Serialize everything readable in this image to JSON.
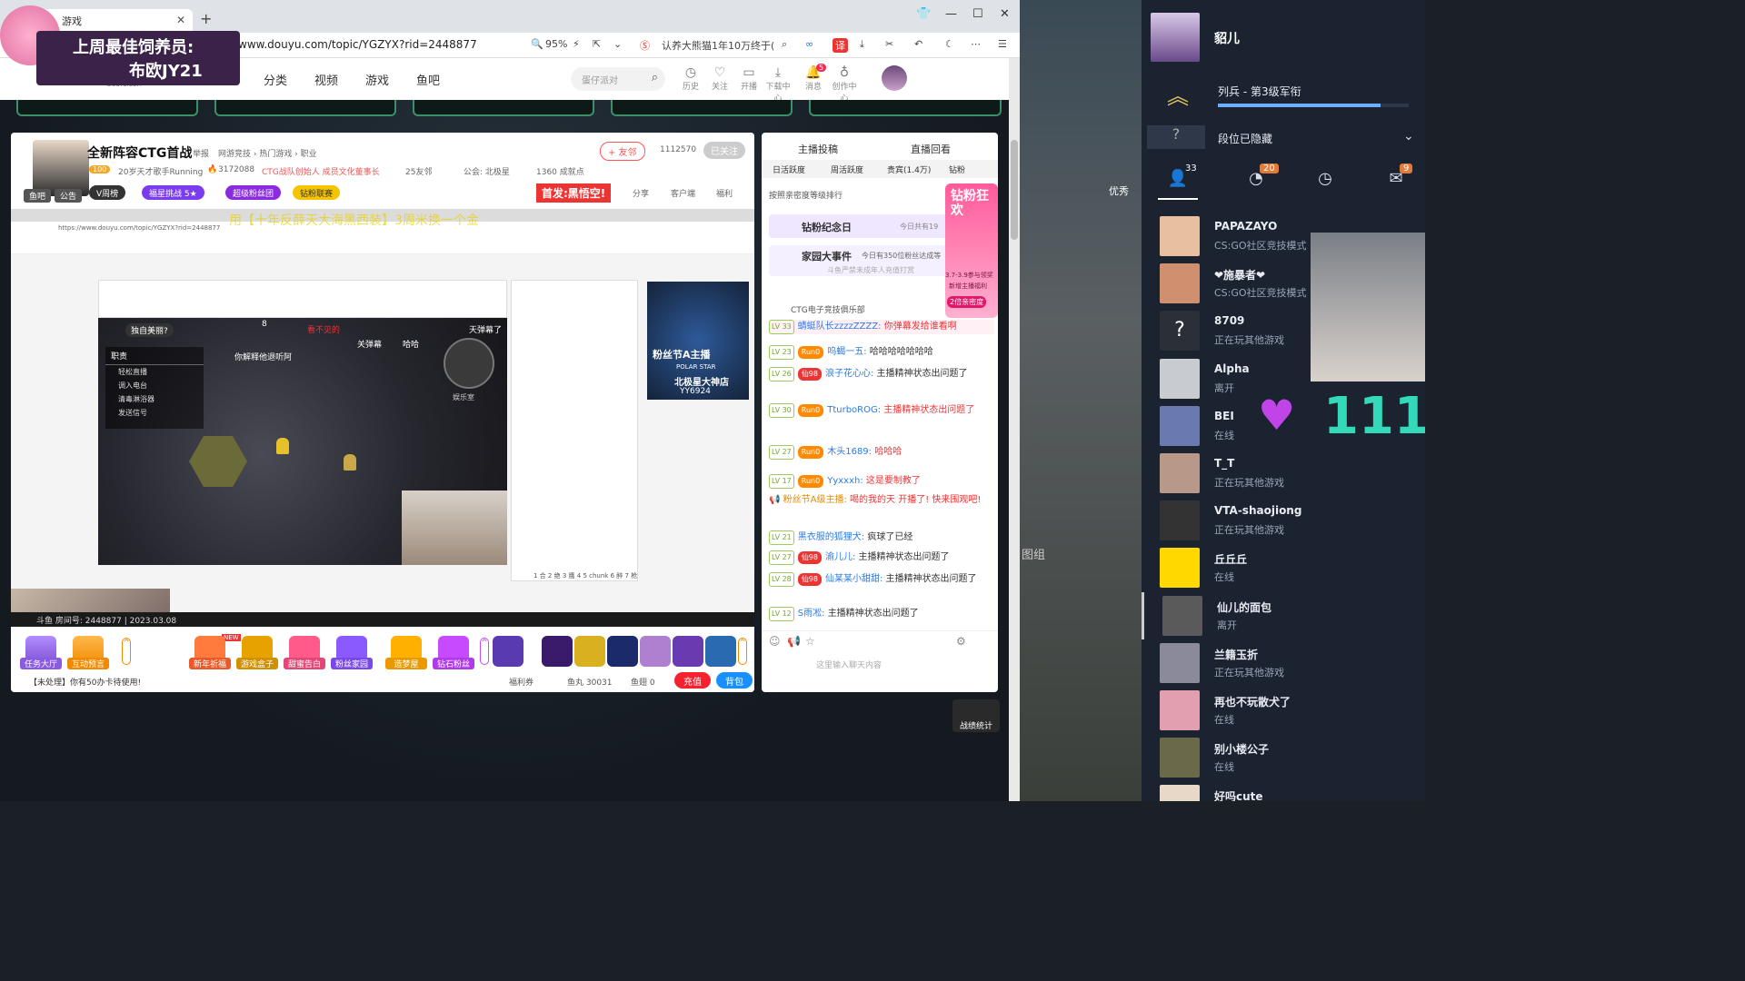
{
  "browser": {
    "tab_title": "游戏",
    "url": "www.douyu.com/topic/YGZYX?rid=2448877",
    "url_prefix": ".",
    "zoom": "95%",
    "news_ticker": "认养大熊猫1年10万终于(",
    "translate_badge": "译"
  },
  "overlay": {
    "line1": "上周最佳饲养员:",
    "line2": "布欧JY21"
  },
  "site": {
    "logo": "DOUYU.COM",
    "nav": [
      "分类",
      "视频",
      "游戏",
      "鱼吧"
    ],
    "search_placeholder": "蛋仔派对",
    "header_icons": [
      {
        "label": "历史"
      },
      {
        "label": "关注"
      },
      {
        "label": "开播"
      },
      {
        "label": "下载中心"
      },
      {
        "label": "消息",
        "badge": "5"
      },
      {
        "label": "创作中心"
      }
    ]
  },
  "room": {
    "title": "全新阵容CTG首战",
    "report": "举报",
    "breadcrumb": "网游竞技 › 热门游戏 › 职业",
    "follow_label": "+ 友邻",
    "follow_count": "1112570",
    "followed_label": "已关注",
    "level": "100",
    "desc": "20岁天才歌手Running",
    "hot": "3172088",
    "tag_line": "CTG战队创始人 成员文化董事长",
    "fans": "25友邻",
    "guild": "公会: 北极星",
    "achievements": "1360 成就点",
    "pills": [
      "V周榜",
      "福星挑战 5★",
      "超级粉丝团",
      "钻粉联赛"
    ],
    "tabs_left": [
      "鱼吧",
      "公告"
    ],
    "promo": "首发:黑悟空!",
    "actions": [
      "分享",
      "客户端",
      "福利"
    ]
  },
  "video": {
    "marquee": "用【十年反薛天大海黑西装】3周米换一个金",
    "nested_url": "https://www.douyu.com/topic/YGZYX?rid=2448877",
    "game_tags": [
      "独自美丽?",
      "看不见的",
      "关弹幕",
      "哈哈",
      "天弹幕了",
      "8",
      "你解释他退听阿"
    ],
    "duty_label": "职责",
    "duty_items": [
      "轻松直播",
      "调入电台",
      "清毒淋浴器",
      "发送信号"
    ],
    "room_label": "娱乐室",
    "bottom_info": "斗鱼 房间号: 2448877 | 2023.03.08",
    "festival": "粉丝节A主播",
    "festival_sub": "POLAR STAR",
    "polar": "北极星大神店",
    "polar_code": "YY6924",
    "nested_chat_tabs": [
      "1 合",
      "2 绝",
      "3 鹰",
      "4",
      "5 chunk",
      "6 醉",
      "7 枪"
    ]
  },
  "bottombar": {
    "buttons": [
      "任务大厅",
      "互动预言"
    ],
    "gift_labels": [
      "新年祈福",
      "游戏盒子",
      "甜蜜告白",
      "粉丝家园",
      "造梦屋",
      "钻石粉丝"
    ],
    "notice": "【未处理】你有50办卡待使用!",
    "new_tag": "NEW",
    "welfare": "福利券",
    "fish_balls": "鱼丸 30031",
    "fish_fins": "鱼翅 0",
    "recharge": "充值",
    "backpack": "背包"
  },
  "chat": {
    "top_tabs": [
      "主播投稿",
      "直播回看"
    ],
    "rank_tabs": [
      "日活跃度",
      "周活跃度",
      "贵宾(1.4万)",
      "钻粉"
    ],
    "rank_note": "按照亲密度等级排行",
    "diamond_day": "钻粉纪念日",
    "diamond_day_note": "今日共有19",
    "family_event": "家园大事件",
    "family_note": "今日有350位粉丝达成等",
    "family_sub": "斗鱼严禁未成年人充值打赏",
    "club": "CTG电子竞技俱乐部",
    "promo_tag": "钻粉狂欢",
    "promo_dates": "3.7-3.9参与领奖",
    "promo_sub": "新增主播福利",
    "promo_btn": "2倍亲密度",
    "messages": [
      {
        "lv": "LV 33",
        "user": "蜻蜓队长zzzzZZZZ:",
        "text": "你弹幕发给谁看啊"
      },
      {
        "lv": "LV 23",
        "badge": "Run0",
        "user": "呜蝎一五:",
        "text": "哈哈哈哈哈哈哈"
      },
      {
        "lv": "LV 26",
        "badge": "仙98",
        "user": "浪子花心心:",
        "text": "主播精神状态出问题了"
      },
      {
        "lv": "LV 30",
        "badge": "Run0",
        "user": "TturboROG:",
        "text": "主播精神状态出问题了"
      },
      {
        "lv": "LV 27",
        "badge": "Run0",
        "user": "木头1689:",
        "text": "哈哈哈"
      },
      {
        "lv": "LV 17",
        "badge": "Run0",
        "user": "Yyxxxh:",
        "text": "这是要制教了"
      },
      {
        "lv": "",
        "user": "粉丝节A级主播:",
        "text": "喝的我的天 开播了! 快来围观吧!"
      },
      {
        "lv": "LV 21",
        "user": "黑衣服的狐狸犬:",
        "text": "疯球了已经"
      },
      {
        "lv": "LV 27",
        "badge": "仙98",
        "user": "渝儿儿:",
        "text": "主播精神状态出问题了"
      },
      {
        "lv": "LV 28",
        "badge": "仙98",
        "user": "仙某某小甜甜:",
        "text": "主播精神状态出问题了"
      },
      {
        "lv": "LV 12",
        "user": "S雨凇:",
        "text": "主播精神状态出问题了"
      }
    ],
    "input_placeholder": "这里输入聊天内容",
    "stats_label": "战绩统计"
  },
  "friends": {
    "me": {
      "name": "貂儿",
      "rank": "列兵 - 第3级军衔",
      "rank_progress": 0.85,
      "segment": "段位已隐藏"
    },
    "tabs": [
      {
        "icon": "friends-icon",
        "count": "33"
      },
      {
        "icon": "broadcast-icon",
        "count": "20"
      },
      {
        "icon": "history-icon",
        "count": ""
      },
      {
        "icon": "mail-icon",
        "count": "9"
      }
    ],
    "list": [
      {
        "name": "PAPAZAYO",
        "status": "CS:GO社区竞技模式"
      },
      {
        "name": "❤施暴者❤",
        "status": "CS:GO社区竞技模式"
      },
      {
        "name": "8709",
        "status": "正在玩其他游戏"
      },
      {
        "name": "Alpha",
        "status": "离开"
      },
      {
        "name": "BEI",
        "status": "在线"
      },
      {
        "name": "T_T",
        "status": "正在玩其他游戏"
      },
      {
        "name": "VTA-shaojiong",
        "status": "正在玩其他游戏"
      },
      {
        "name": "丘丘丘",
        "status": "在线"
      },
      {
        "name": "仙儿的面包",
        "status": "离开"
      },
      {
        "name": "兰籍玉折",
        "status": "正在玩其他游戏"
      },
      {
        "name": "再也不玩散犬了",
        "status": "在线"
      },
      {
        "name": "别小楼公子",
        "status": "在线"
      },
      {
        "name": "好吗cute",
        "status": ""
      }
    ],
    "heart_count": "111",
    "side_label": "优秀",
    "side_label2": "图组"
  }
}
